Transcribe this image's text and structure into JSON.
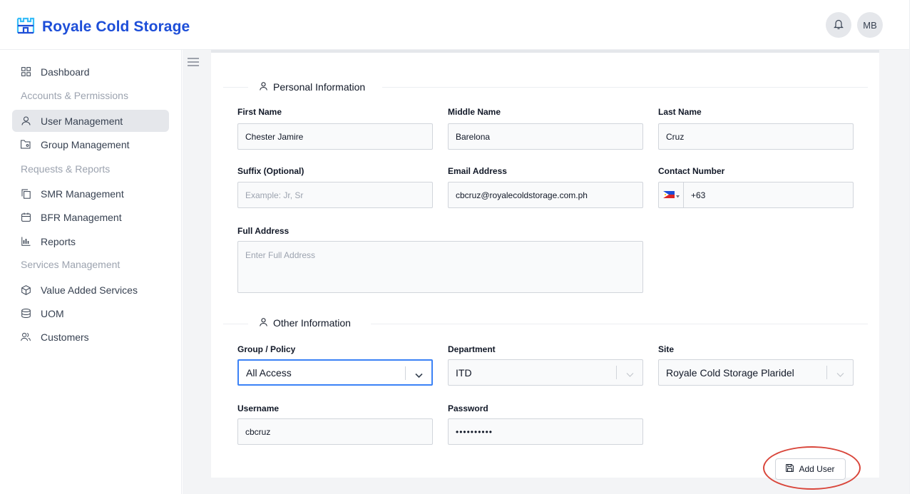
{
  "app": {
    "title": "Royale Cold Storage"
  },
  "header": {
    "avatar_initials": "MB"
  },
  "sidebar": {
    "dashboard": "Dashboard",
    "section_accounts": "Accounts & Permissions",
    "user_management": "User Management",
    "group_management": "Group Management",
    "section_requests": "Requests & Reports",
    "smr_management": "SMR Management",
    "bfr_management": "BFR Management",
    "reports": "Reports",
    "section_services": "Services Management",
    "value_added_services": "Value Added Services",
    "uom": "UOM",
    "customers": "Customers",
    "active_item": "User Management"
  },
  "form": {
    "personal_section": "Personal Information",
    "first_name_label": "First Name",
    "first_name_value": "Chester Jamire",
    "middle_name_label": "Middle Name",
    "middle_name_value": "Barelona",
    "last_name_label": "Last Name",
    "last_name_value": "Cruz",
    "suffix_label": "Suffix (Optional)",
    "suffix_placeholder": "Example: Jr, Sr",
    "email_label": "Email Address",
    "email_value": "cbcruz@royalecoldstorage.com.ph",
    "contact_label": "Contact Number",
    "contact_value": "+63",
    "address_label": "Full Address",
    "address_placeholder": "Enter Full Address",
    "other_section": "Other Information",
    "group_label": "Group / Policy",
    "group_value": "All Access",
    "department_label": "Department",
    "department_value": "ITD",
    "site_label": "Site",
    "site_value": "Royale Cold Storage Plaridel",
    "username_label": "Username",
    "username_value": "cbcruz",
    "password_label": "Password",
    "password_value": "••••••••••",
    "submit_label": "Add User"
  },
  "colors": {
    "brand": "#1d4ed8",
    "focus": "#3b82f6",
    "highlight": "#d9463b"
  },
  "icons": {
    "logo": "castle-logo-icon",
    "notification": "bell-icon",
    "menu": "hamburger-icon",
    "section": "user-icon",
    "submit": "save-icon",
    "dropdown": "chevron-down-icon",
    "flag": "philippines-flag-icon"
  }
}
